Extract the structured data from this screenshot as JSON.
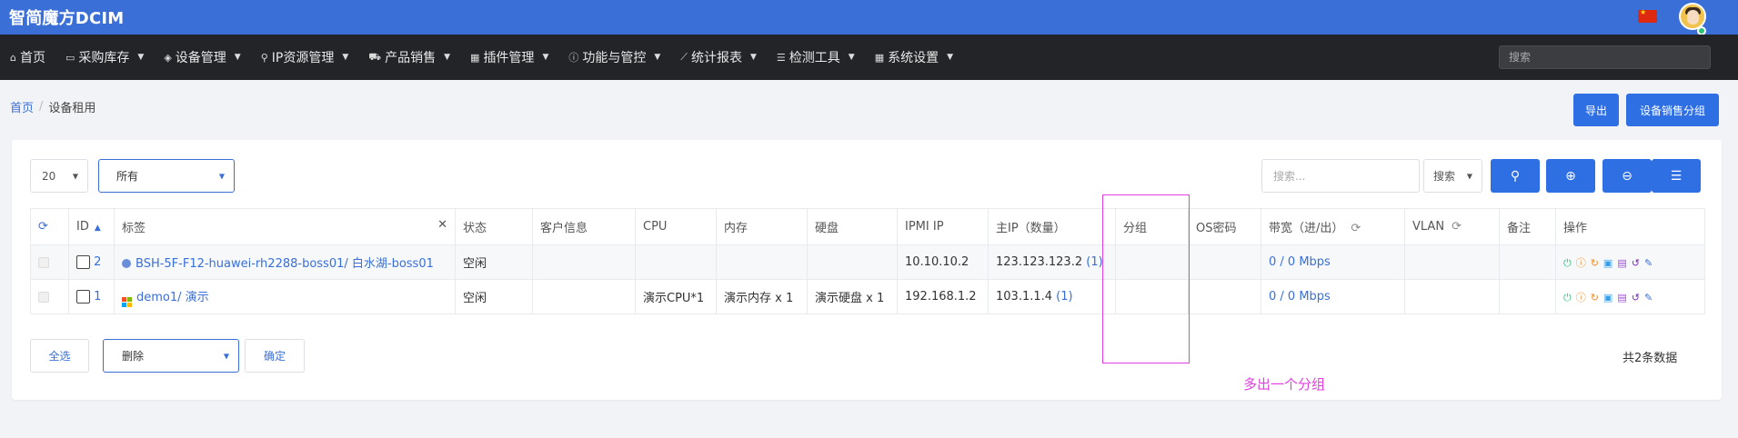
{
  "header": {
    "brand": "智简魔方DCIM"
  },
  "nav": {
    "items": [
      {
        "label": "首页",
        "icon": "home-icon",
        "caret": false
      },
      {
        "label": "采购库存",
        "icon": "cart-icon",
        "caret": true
      },
      {
        "label": "设备管理",
        "icon": "cube-icon",
        "caret": true
      },
      {
        "label": "IP资源管理",
        "icon": "map-marker-icon",
        "caret": true
      },
      {
        "label": "产品销售",
        "icon": "shopping-cart-icon",
        "caret": true
      },
      {
        "label": "插件管理",
        "icon": "grid-icon",
        "caret": true
      },
      {
        "label": "功能与管控",
        "icon": "info-circle-icon",
        "caret": true
      },
      {
        "label": "统计报表",
        "icon": "line-chart-icon",
        "caret": true
      },
      {
        "label": "检测工具",
        "icon": "list-icon",
        "caret": true
      },
      {
        "label": "系统设置",
        "icon": "grid-icon",
        "caret": true
      }
    ],
    "search_placeholder": "搜索"
  },
  "breadcrumb": {
    "home": "首页",
    "separator": "/",
    "current": "设备租用"
  },
  "actions": {
    "export": "导出",
    "sale_group": "设备销售分组"
  },
  "toolbar": {
    "per_page": "20",
    "filter": "所有",
    "search_placeholder": "搜索...",
    "search_type": "搜索"
  },
  "table": {
    "headers": {
      "id": "ID",
      "label": "标签",
      "status": "状态",
      "customer": "客户信息",
      "cpu": "CPU",
      "memory": "内存",
      "disk": "硬盘",
      "ipmi": "IPMI IP",
      "main_ip": "主IP（数量）",
      "group": "分组",
      "os_pwd": "OS密码",
      "bandwidth": "带宽（进/出）",
      "vlan": "VLAN",
      "remark": "备注",
      "ops": "操作"
    },
    "rows": [
      {
        "id": "2",
        "label": "BSH-5F-F12-huawei-rh2288-boss01/ 白水湖-boss01",
        "status": "空闲",
        "customer": "",
        "cpu": "",
        "memory": "",
        "disk": "",
        "ipmi": "10.10.10.2",
        "main_ip": "123.123.123.2",
        "ip_count": "(1)",
        "group": "",
        "os_pwd": "",
        "bandwidth": "0 / 0 Mbps",
        "vlan": "",
        "remark": ""
      },
      {
        "id": "1",
        "label": "demo1/ 演示",
        "status": "空闲",
        "customer": "",
        "cpu": "演示CPU*1",
        "memory": "演示内存 x 1",
        "disk": "演示硬盘 x 1",
        "ipmi": "192.168.1.2",
        "main_ip": "103.1.1.4",
        "ip_count": "(1)",
        "group": "",
        "os_pwd": "",
        "bandwidth": "0 / 0 Mbps",
        "vlan": "",
        "remark": ""
      }
    ]
  },
  "footer": {
    "select_all": "全选",
    "bulk_action": "删除",
    "confirm": "确定",
    "total": "共2条数据"
  },
  "annotation": {
    "text": "多出一个分组",
    "color": "#e040e0"
  },
  "colors": {
    "primary": "#2f6fe4",
    "topbar": "#3a6fd8",
    "navbar": "#222427"
  }
}
